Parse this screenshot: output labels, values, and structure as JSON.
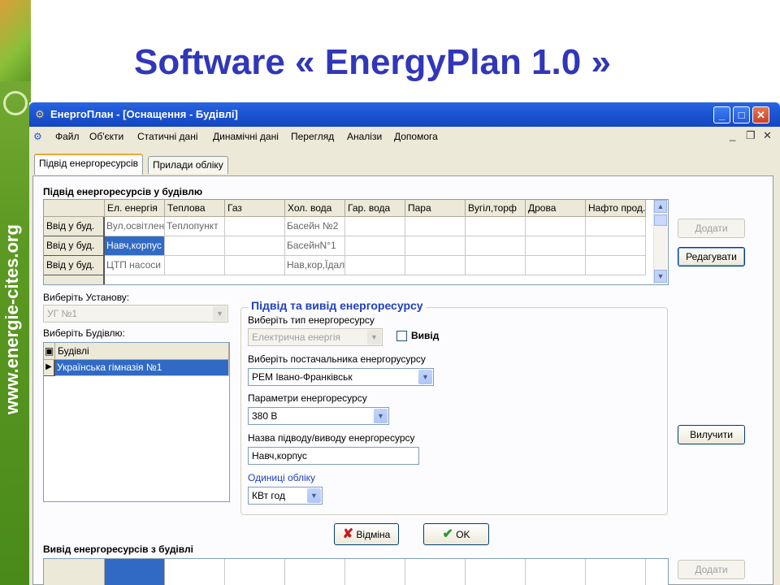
{
  "slide": {
    "title": "Software « EnergyPlan 1.0 »",
    "side_text": "www.energie-cites.org"
  },
  "window": {
    "title": "ЕнергоПлан - [Оснащення - Будівлі]",
    "controls": {
      "minimize": "_",
      "maximize": "□",
      "close": "✕"
    }
  },
  "menu": {
    "items": [
      "Файл",
      "Об'єкти",
      "Статичні дані",
      "Динамічні дані",
      "Перегляд",
      "Аналізи",
      "Допомога"
    ],
    "mdi_controls": {
      "minimize": "_",
      "restore": "❐",
      "close": "✕"
    }
  },
  "tabs": [
    {
      "label": "Підвід енергоресурсів",
      "active": true
    },
    {
      "label": "Прилади обліку",
      "active": false
    }
  ],
  "supply_section": {
    "title": "Підвід енергоресурсів у будівлю",
    "columns": [
      "Ел. енергія",
      "Теплова",
      "Газ",
      "Хол. вода",
      "Гар. вода",
      "Пара",
      "Вугіл,торф",
      "Дрова",
      "Нафто прод."
    ],
    "rows": [
      {
        "header": "Ввід у буд.",
        "cells": [
          "Вул,освітлен",
          "Теплопункт",
          "",
          "Басейн №2",
          "",
          "",
          "",
          "",
          ""
        ]
      },
      {
        "header": "Ввід у буд.",
        "cells": [
          "Навч,корпус",
          "",
          "",
          "БасейнN°1",
          "",
          "",
          "",
          "",
          ""
        ]
      },
      {
        "header": "Ввід у буд.",
        "cells": [
          "ЦТП насоси",
          "",
          "",
          "Нав,кор,Їдал",
          "",
          "",
          "",
          "",
          ""
        ]
      }
    ],
    "selected_cell": "Навч,корпус",
    "buttons": {
      "add": "Додати",
      "edit": "Редагувати"
    }
  },
  "left_panel": {
    "institution_label": "Виберіть Установу:",
    "institution_value": "УГ №1",
    "building_label": "Виберіть Будівлю:",
    "building_column": "Будівлі",
    "building_rows": [
      "Українська гімназія №1"
    ]
  },
  "groupbox": {
    "title": "Підвід та вивід енергоресурсу",
    "type_label": "Виберіть тип енергоресурсу",
    "type_value": "Електрична енергія",
    "output_checkbox_label": "Вивід",
    "output_checked": false,
    "supplier_label": "Виберіть постачальника енергорусурсу",
    "supplier_value": "РЕМ Івано-Франківськ",
    "params_label": "Параметри енергоресурсу",
    "params_value": "380 В",
    "name_label": "Назва підводу/виводу енергоресурсу",
    "name_value": "Навч,корпус",
    "units_label": "Одиниці обліку",
    "units_value": "КВт год"
  },
  "side_buttons": {
    "remove": "Вилучити"
  },
  "dialog_buttons": {
    "cancel": "Відміна",
    "ok": "OK"
  },
  "output_section": {
    "title": "Вивід енергоресурсів з будівлі",
    "add": "Додати"
  },
  "colors": {
    "slide_title": "#3137b8",
    "titlebar": "#1d56d6",
    "selection": "#316ac5",
    "side_strip": "#5d9a23"
  }
}
